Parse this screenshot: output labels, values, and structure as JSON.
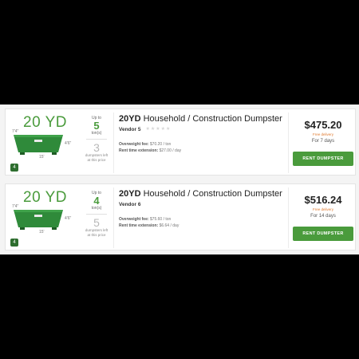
{
  "accent_color": "#4a9b3c",
  "listings": [
    {
      "size": "20 YD",
      "dim_height": "4'6\"",
      "dim_width": "7'4\"",
      "dim_length": "15'",
      "badge": "4",
      "up_to": "Up to",
      "tons": "5",
      "tons_unit": "ton(s)",
      "dumpsters_left": "3",
      "dumpsters_left_text": "dumpsters left at this price",
      "title_bold": "20YD",
      "title_rest": "Household / Construction Dumpster",
      "vendor": "Vendor 5",
      "rating": 0,
      "overweight_label": "Overweight fee:",
      "overweight_value": "$70.20 / ton",
      "extension_label": "Rent time extension:",
      "extension_value": "$27.00 / day",
      "price": "$475.20",
      "free_delivery": "Free delivery",
      "rental_days": "For 7 days",
      "button": "RENT DUMPSTER"
    },
    {
      "size": "20 YD",
      "dim_height": "4'6\"",
      "dim_width": "7'4\"",
      "dim_length": "15'",
      "badge": "4",
      "up_to": "Up to",
      "tons": "4",
      "tons_unit": "ton(s)",
      "dumpsters_left": "5",
      "dumpsters_left_text": "dumpsters left at this price",
      "title_bold": "20YD",
      "title_rest": "Household / Construction Dumpster",
      "vendor": "Vendor 6",
      "rating": 0,
      "overweight_label": "Overweight fee:",
      "overweight_value": "$75.60 / ton",
      "extension_label": "Rent time extension:",
      "extension_value": "$6.64 / day",
      "price": "$516.24",
      "free_delivery": "Free delivery",
      "rental_days": "For 14 days",
      "button": "RENT DUMPSTER"
    }
  ]
}
